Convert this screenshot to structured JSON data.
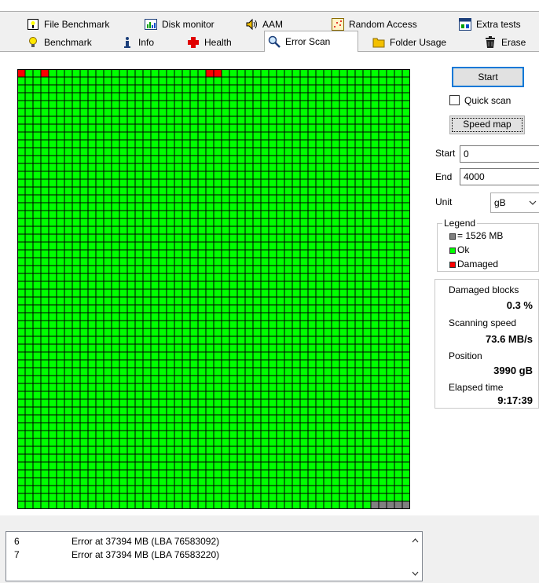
{
  "tabs": {
    "row1": [
      {
        "id": "file-benchmark",
        "label": "File Benchmark",
        "icon": "file-benchmark-icon"
      },
      {
        "id": "disk-monitor",
        "label": "Disk monitor",
        "icon": "disk-monitor-icon"
      },
      {
        "id": "aam",
        "label": "AAM",
        "icon": "speaker-icon"
      },
      {
        "id": "random-access",
        "label": "Random Access",
        "icon": "random-access-icon"
      },
      {
        "id": "extra-tests",
        "label": "Extra tests",
        "icon": "extra-tests-icon"
      }
    ],
    "row2": [
      {
        "id": "benchmark",
        "label": "Benchmark",
        "icon": "lightbulb-icon"
      },
      {
        "id": "info",
        "label": "Info",
        "icon": "info-icon"
      },
      {
        "id": "health",
        "label": "Health",
        "icon": "health-cross-icon"
      },
      {
        "id": "error-scan",
        "label": "Error Scan",
        "icon": "magnifier-icon",
        "active": true
      },
      {
        "id": "folder-usage",
        "label": "Folder Usage",
        "icon": "folder-icon"
      },
      {
        "id": "erase",
        "label": "Erase",
        "icon": "trash-icon"
      }
    ]
  },
  "controls": {
    "start_button": "Start",
    "quick_scan_label": "Quick scan",
    "quick_scan_checked": false,
    "speed_map_button": "Speed map",
    "start_label": "Start",
    "start_value": "0",
    "end_label": "End",
    "end_value": "4000",
    "unit_label": "Unit",
    "unit_value": "gB"
  },
  "legend": {
    "title": "Legend",
    "block_size": "= 1526 MB",
    "ok": "Ok",
    "damaged": "Damaged"
  },
  "stats": {
    "damaged_blocks_label": "Damaged blocks",
    "damaged_blocks_value": "0.3 %",
    "scanning_speed_label": "Scanning speed",
    "scanning_speed_value": "73.6 MB/s",
    "position_label": "Position",
    "position_value": "3990 gB",
    "elapsed_label": "Elapsed time",
    "elapsed_value": "9:17:39"
  },
  "grid": {
    "columns": 50,
    "rows": 56,
    "damaged_blocks": [
      [
        0,
        0
      ],
      [
        0,
        3
      ],
      [
        0,
        24
      ],
      [
        0,
        25
      ]
    ],
    "unscanned_last_row_from": 45
  },
  "log": [
    {
      "n": "6",
      "text": "Error at 37394 MB (LBA 76583092)"
    },
    {
      "n": "7",
      "text": "Error at 37394 MB (LBA 76583220)"
    }
  ],
  "colors": {
    "ok": "#00ff00",
    "damaged": "#ff0000",
    "unscanned": "#808080",
    "grid_line": "#000000",
    "accent": "#0078d7"
  }
}
